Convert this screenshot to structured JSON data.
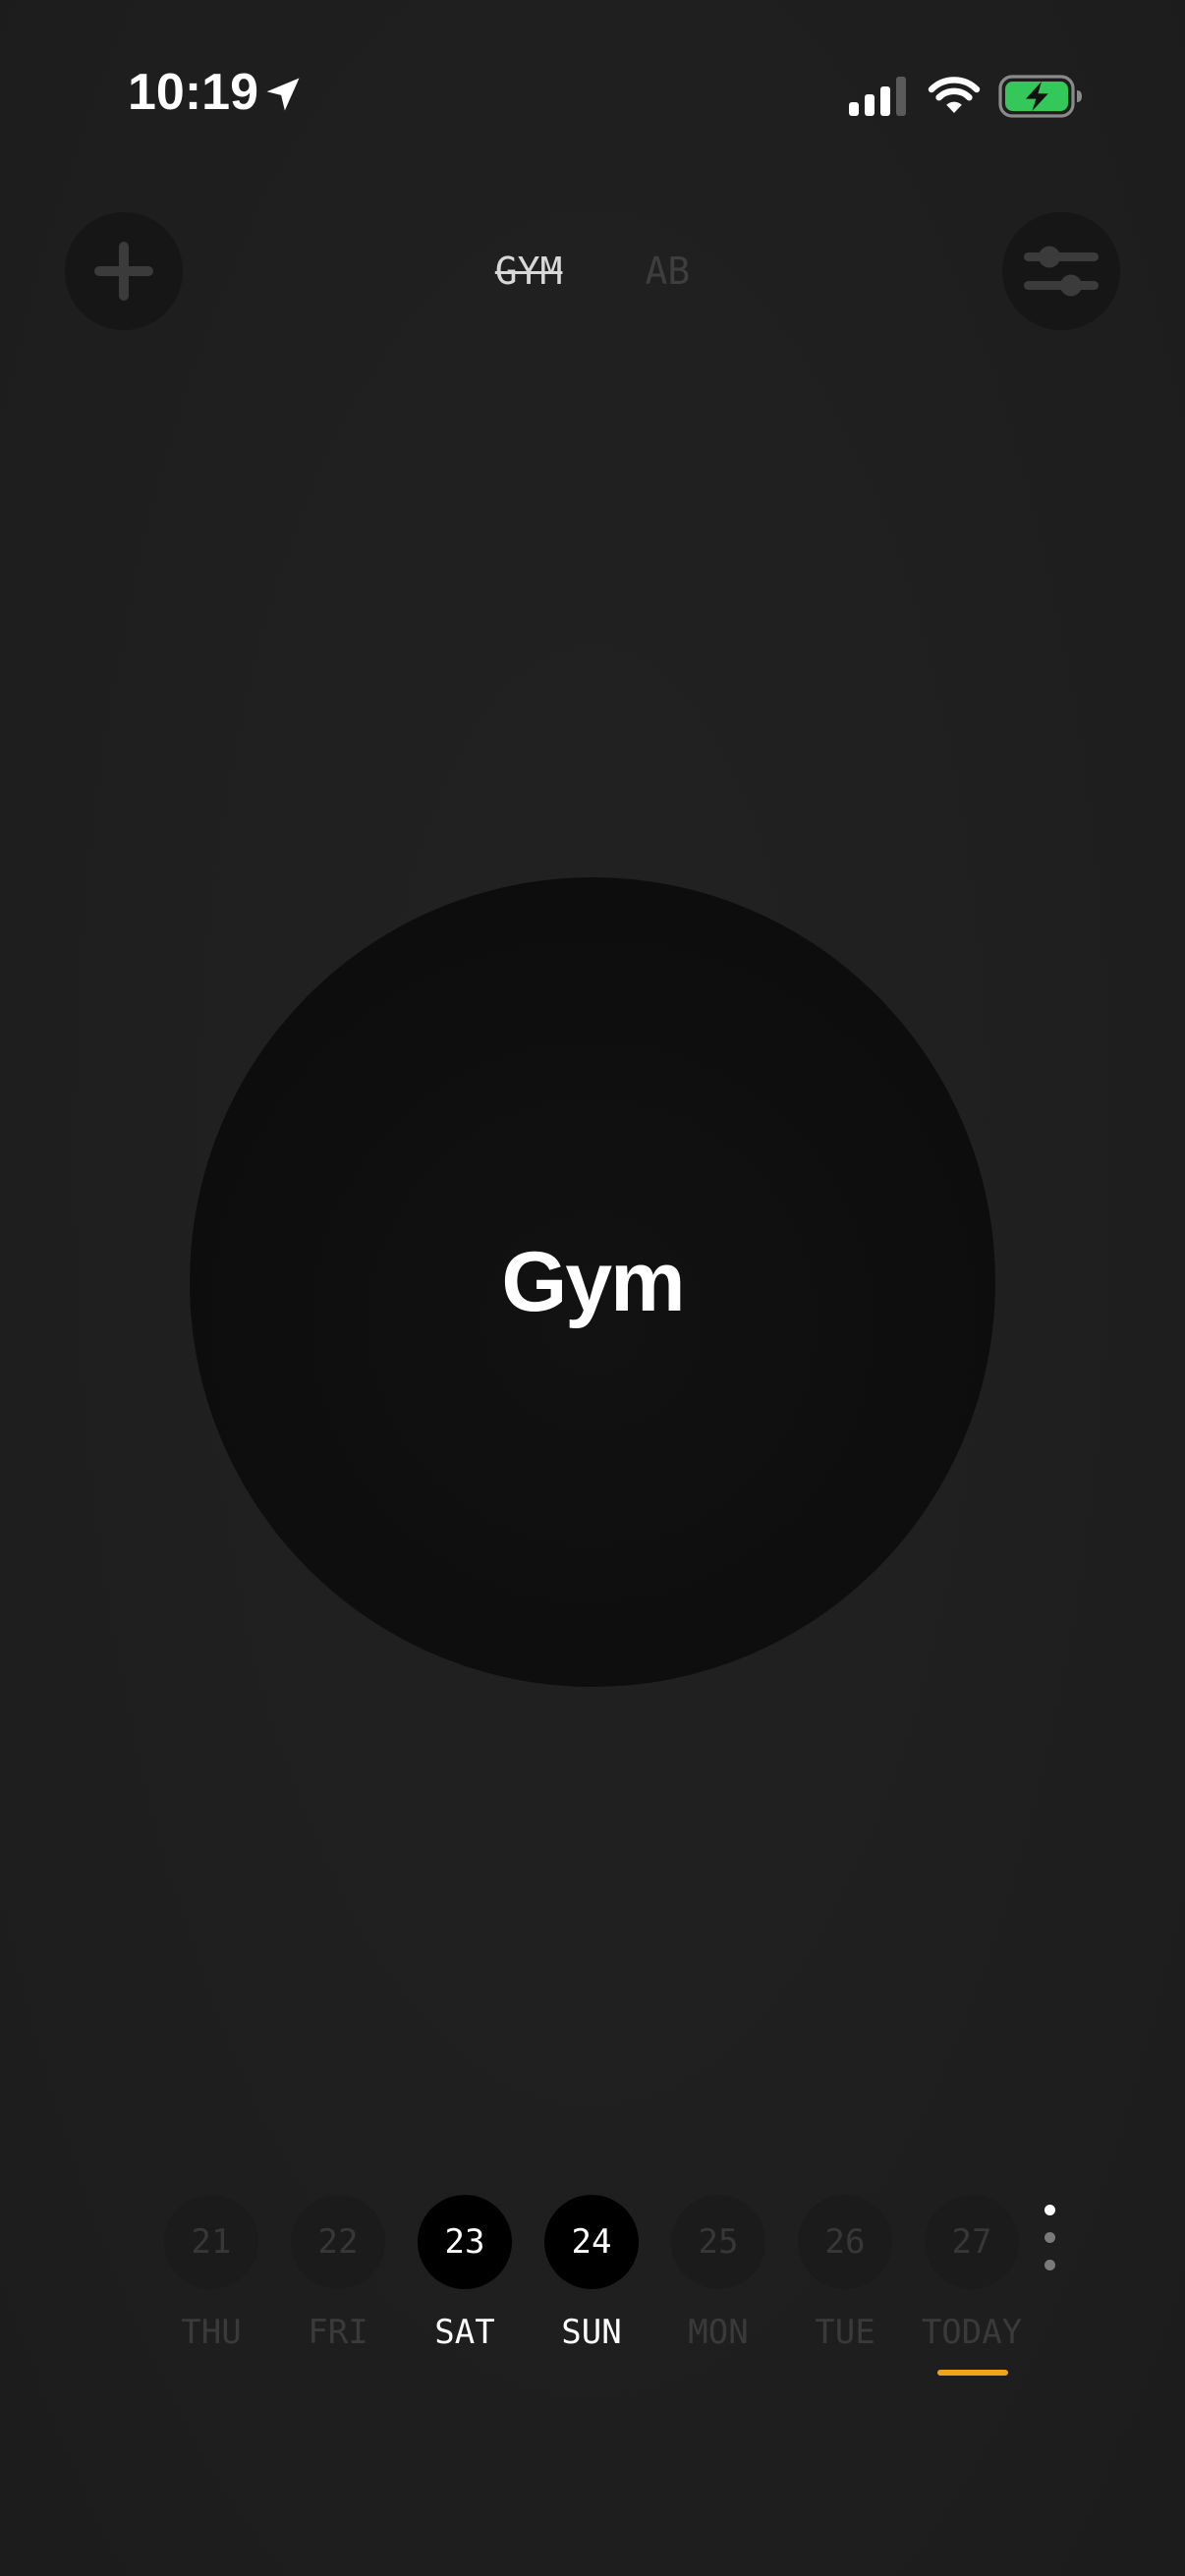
{
  "status_bar": {
    "time": "10:19",
    "icons": [
      "location-arrow-icon",
      "cellular-signal-icon",
      "wifi-icon",
      "battery-charging-icon"
    ],
    "battery_color": "#34c759"
  },
  "header": {
    "add_icon": "plus-icon",
    "settings_icon": "sliders-icon",
    "tabs": [
      {
        "label": "GYM",
        "completed": true
      },
      {
        "label": "AB",
        "completed": false
      }
    ]
  },
  "main": {
    "habit_name": "Gym"
  },
  "days": [
    {
      "number": "21",
      "label": "THU",
      "done": false
    },
    {
      "number": "22",
      "label": "FRI",
      "done": false
    },
    {
      "number": "23",
      "label": "SAT",
      "done": true
    },
    {
      "number": "24",
      "label": "SUN",
      "done": true
    },
    {
      "number": "25",
      "label": "MON",
      "done": false
    },
    {
      "number": "26",
      "label": "TUE",
      "done": false
    },
    {
      "number": "27",
      "label": "TODAY",
      "done": false,
      "is_today": true
    }
  ],
  "more_icon": "vertical-ellipsis-icon",
  "colors": {
    "background": "#1f1f1f",
    "today_accent": "#f2a31c"
  }
}
